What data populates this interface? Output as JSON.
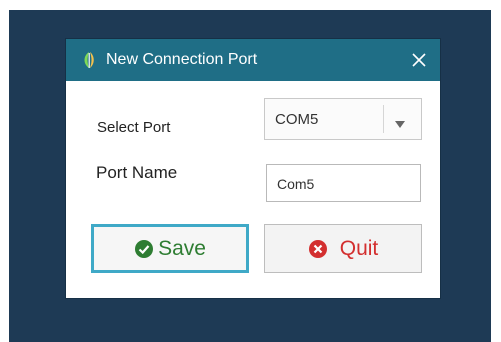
{
  "dialog": {
    "title": "New Connection Port",
    "app_icon": "leaf-logo-icon",
    "close_icon": "close-icon"
  },
  "form": {
    "port_label": "Select Port",
    "port_value": "COM5",
    "name_label": "Port Name",
    "name_value": "Com5"
  },
  "buttons": {
    "save_label": "Save",
    "save_icon": "check-circle-icon",
    "quit_label": "Quit",
    "quit_icon": "x-circle-icon"
  },
  "colors": {
    "titlebar": "#1f6e86",
    "backdrop": "#1e3a55",
    "save_text": "#2e7d32",
    "quit_text": "#d32f2f",
    "focus_border": "#3fa9c7"
  }
}
